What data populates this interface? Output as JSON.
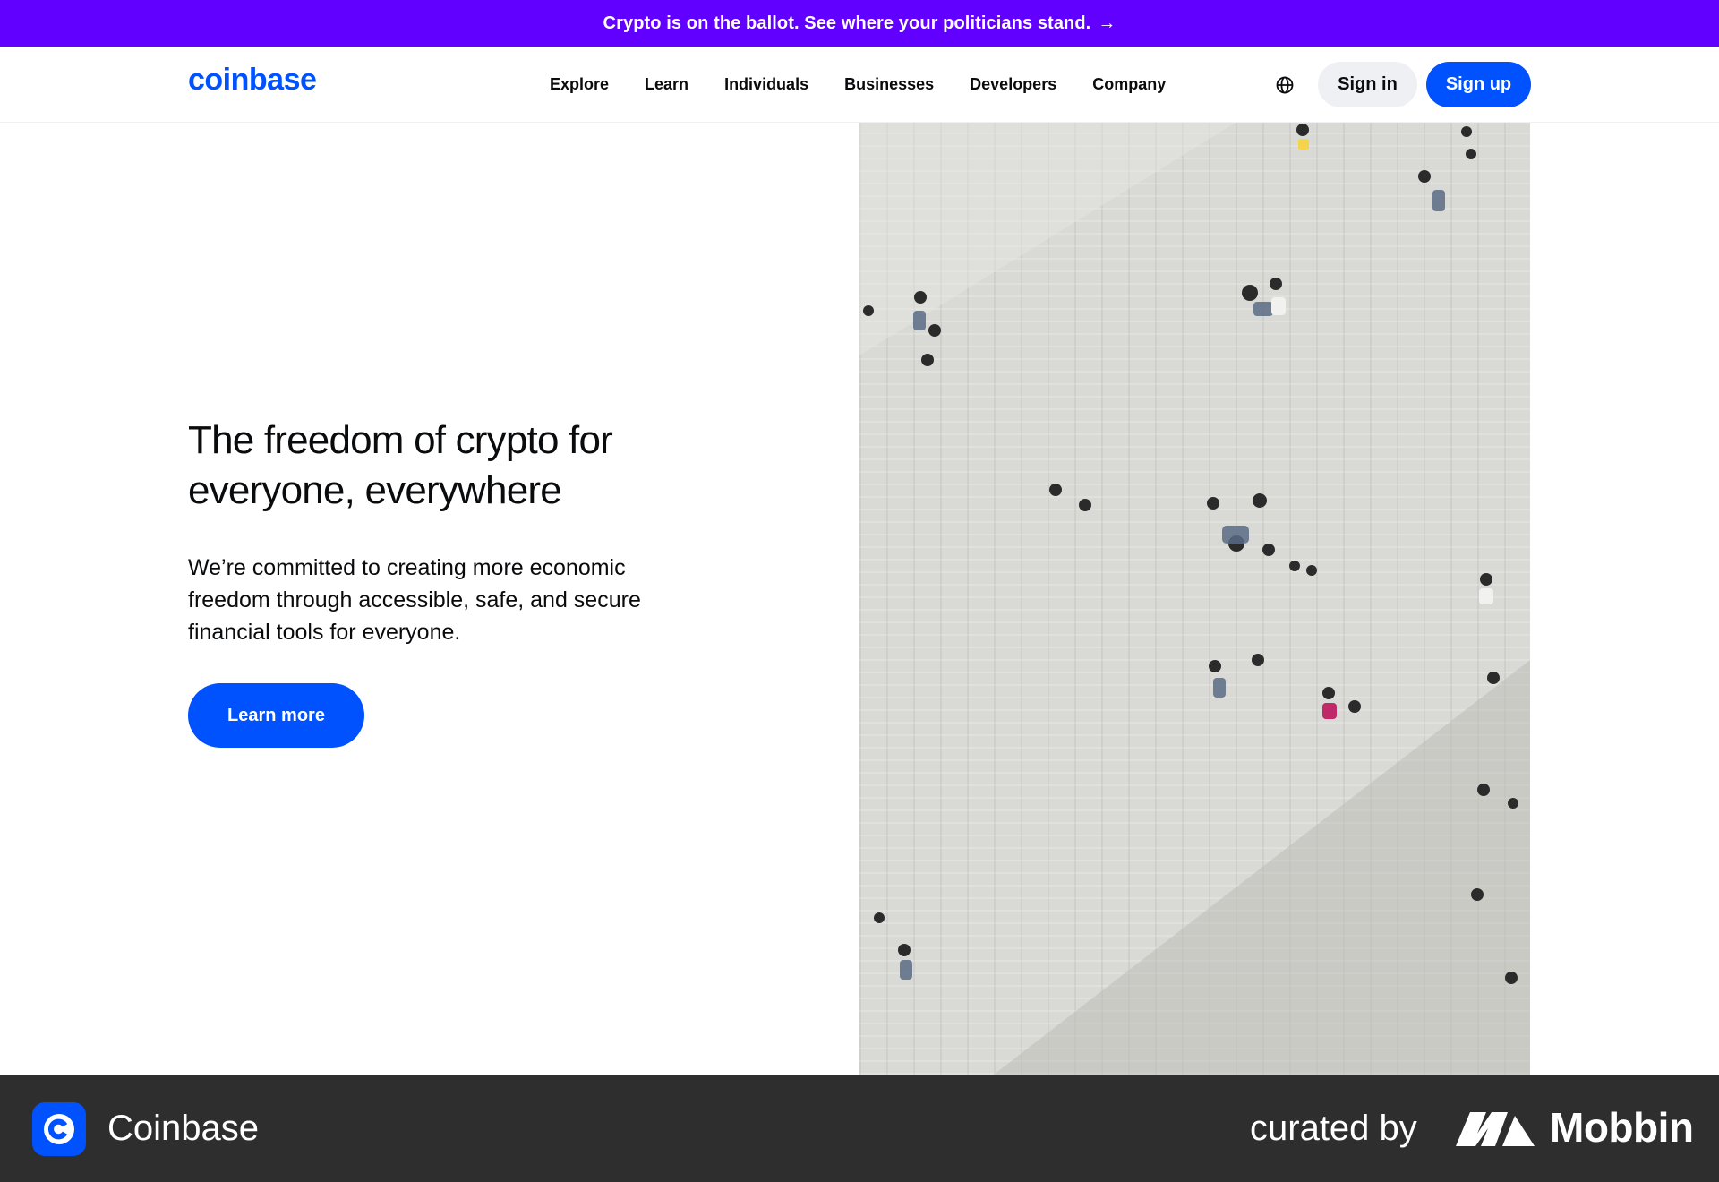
{
  "banner": {
    "text": "Crypto is on the ballot. See where your politicians stand.",
    "arrow": "→"
  },
  "header": {
    "logo": "coinbase",
    "nav": [
      "Explore",
      "Learn",
      "Individuals",
      "Businesses",
      "Developers",
      "Company"
    ],
    "language_icon": "globe-icon",
    "sign_in": "Sign in",
    "sign_up": "Sign up"
  },
  "hero": {
    "title": "The freedom of crypto for everyone, everywhere",
    "body": "We’re committed to creating more economic freedom through accessible, safe, and secure financial tools for everyone.",
    "cta": "Learn more",
    "image": "aerial photo of people walking on a paved plaza"
  },
  "footer": {
    "app_icon": "coinbase-app-icon",
    "app_name": "Coinbase",
    "curated_by": "curated by",
    "brand": "Mobbin"
  },
  "colors": {
    "banner": "#6100ff",
    "brand_blue": "#0052ff",
    "footer_bg": "#2e2e2e",
    "signin_bg": "#eef0f3"
  }
}
